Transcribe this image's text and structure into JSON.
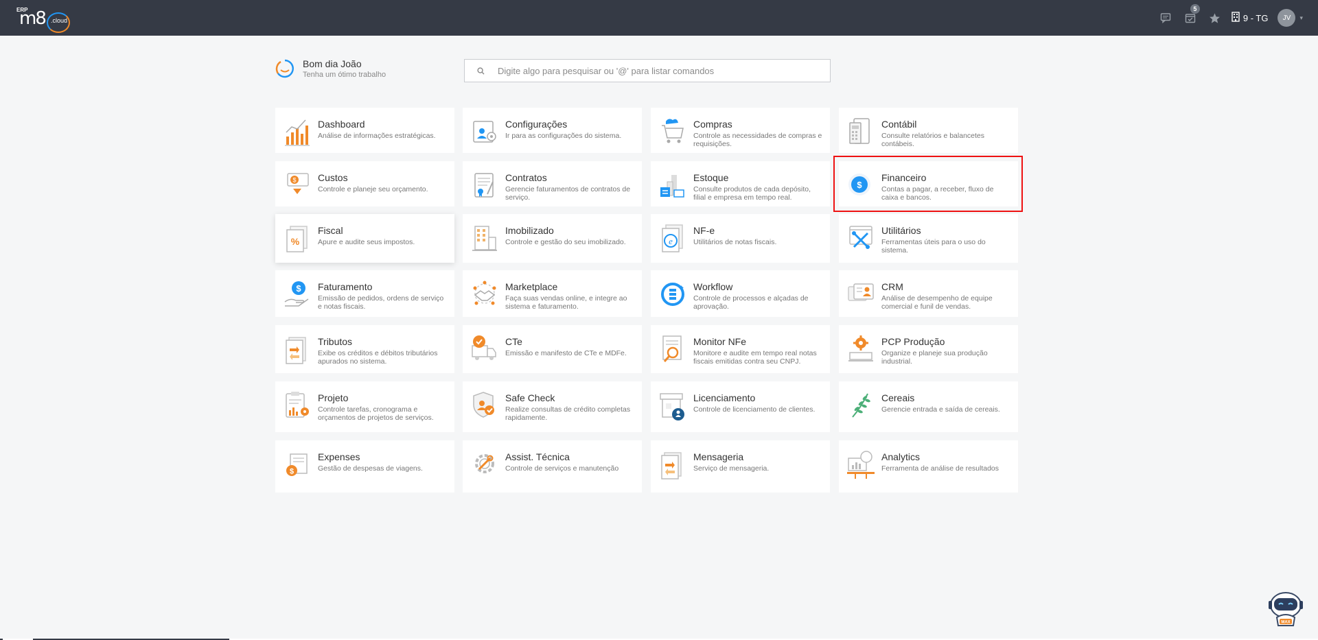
{
  "header": {
    "logo_erp": "ERP",
    "logo_m8": "m8",
    "logo_cloud": ".cloud",
    "notification_count": "5",
    "company": "9 - TG",
    "user_initials": "JV",
    "icons": [
      "chat-icon",
      "calendar-check-icon",
      "star-icon",
      "building-icon"
    ]
  },
  "greeting": {
    "title": "Bom dia João",
    "subtitle": "Tenha um ótimo trabalho"
  },
  "search": {
    "placeholder": "Digite algo para pesquisar ou '@' para listar comandos"
  },
  "modules": [
    {
      "title": "Dashboard",
      "desc": "Análise de informações estratégicas."
    },
    {
      "title": "Configurações",
      "desc": "Ir para as configurações do sistema."
    },
    {
      "title": "Compras",
      "desc": "Controle as necessidades de compras e requisições."
    },
    {
      "title": "Contábil",
      "desc": "Consulte relatórios e balancetes contábeis."
    },
    {
      "title": "Custos",
      "desc": "Controle e planeje seu orçamento."
    },
    {
      "title": "Contratos",
      "desc": "Gerencie faturamentos de contratos de serviço."
    },
    {
      "title": "Estoque",
      "desc": "Consulte produtos de cada depósito, filial e empresa em tempo real."
    },
    {
      "title": "Financeiro",
      "desc": "Contas a pagar, a receber, fluxo de caixa e bancos."
    },
    {
      "title": "Fiscal",
      "desc": "Apure e audite seus impostos."
    },
    {
      "title": "Imobilizado",
      "desc": "Controle e gestão do seu imobilizado."
    },
    {
      "title": "NF-e",
      "desc": "Utilitários de notas fiscais."
    },
    {
      "title": "Utilitários",
      "desc": "Ferramentas úteis para o uso do sistema."
    },
    {
      "title": "Faturamento",
      "desc": "Emissão de pedidos, ordens de serviço e notas fiscais."
    },
    {
      "title": "Marketplace",
      "desc": "Faça suas vendas online, e integre ao sistema e faturamento."
    },
    {
      "title": "Workflow",
      "desc": "Controle de processos e alçadas de aprovação."
    },
    {
      "title": "CRM",
      "desc": "Análise de desempenho de equipe comercial e funil de vendas."
    },
    {
      "title": "Tributos",
      "desc": "Exibe os créditos e débitos tributários apurados no sistema."
    },
    {
      "title": "CTe",
      "desc": "Emissão e manifesto de CTe e MDFe."
    },
    {
      "title": "Monitor NFe",
      "desc": "Monitore e audite em tempo real notas fiscais emitidas contra seu CNPJ."
    },
    {
      "title": "PCP Produção",
      "desc": "Organize e planeje sua produção industrial."
    },
    {
      "title": "Projeto",
      "desc": "Controle tarefas, cronograma e orçamentos de projetos de serviços."
    },
    {
      "title": "Safe Check",
      "desc": "Realize consultas de crédito completas rapidamente."
    },
    {
      "title": "Licenciamento",
      "desc": "Controle de licenciamento de clientes."
    },
    {
      "title": "Cereais",
      "desc": "Gerencie entrada e saída de cereais."
    },
    {
      "title": "Expenses",
      "desc": "Gestão de despesas de viagens."
    },
    {
      "title": "Assist. Técnica",
      "desc": "Controle de serviços e manutenção"
    },
    {
      "title": "Mensageria",
      "desc": "Serviço de mensageria."
    },
    {
      "title": "Analytics",
      "desc": "Ferramenta de análise de resultados"
    }
  ],
  "assistant": {
    "label": "MAX"
  },
  "colors": {
    "topbar": "#353a45",
    "accent_orange": "#f08a2a",
    "accent_blue": "#2196f3",
    "highlight": "#e11111"
  }
}
